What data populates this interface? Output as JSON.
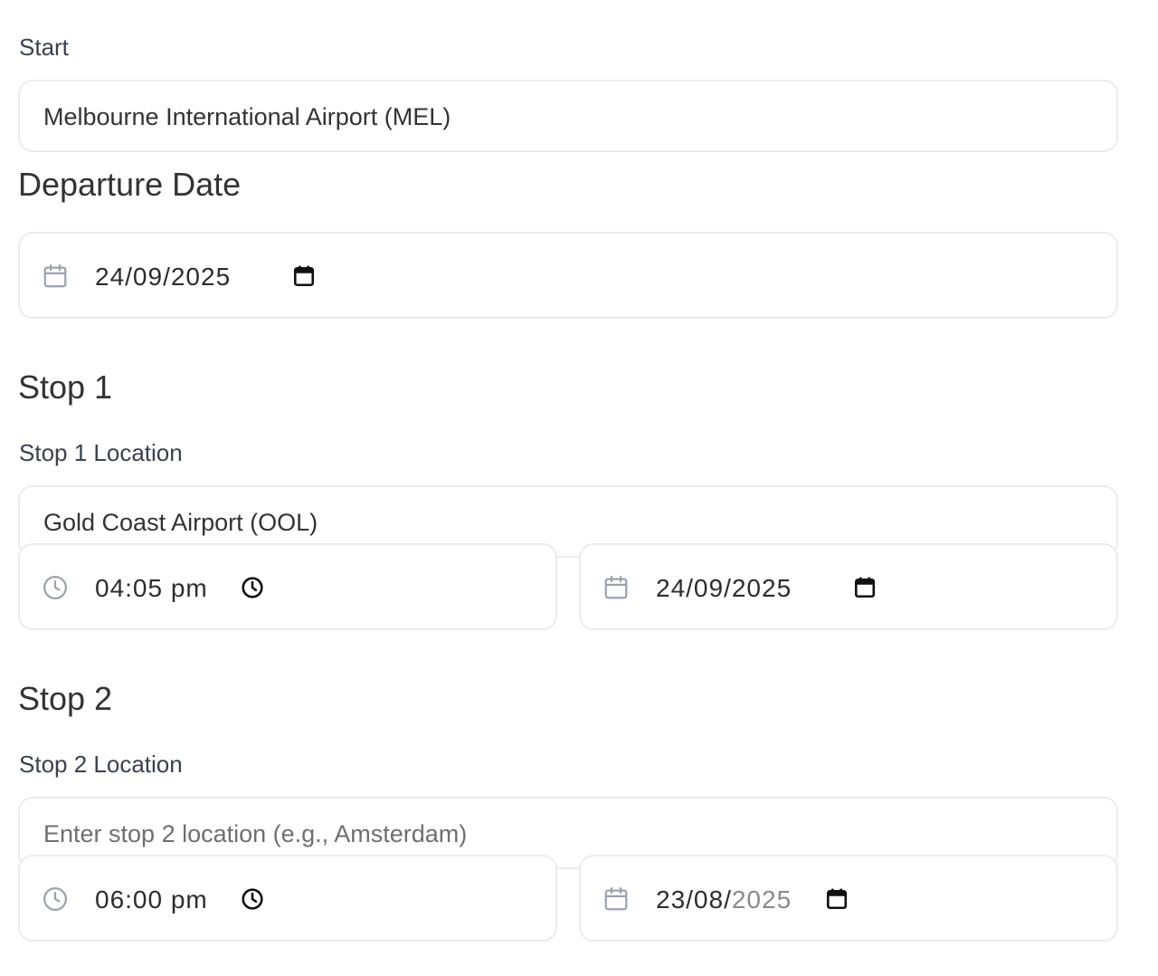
{
  "start": {
    "label": "Start",
    "value": "Melbourne International Airport (MEL)"
  },
  "departure": {
    "heading": "Departure Date",
    "date": "24/09/2025"
  },
  "stops": [
    {
      "heading": "Stop 1",
      "location_label": "Stop 1 Location",
      "location_value": "Gold Coast Airport (OOL)",
      "location_placeholder": "",
      "time": "04:05 pm",
      "date": "24/09/2025",
      "date_day_month": "",
      "date_year": ""
    },
    {
      "heading": "Stop 2",
      "location_label": "Stop 2 Location",
      "location_value": "",
      "location_placeholder": "Enter stop 2 location (e.g., Amsterdam)",
      "time": "06:00 pm",
      "date": "",
      "date_day_month": "23/08/",
      "date_year": "2025"
    }
  ],
  "icons": {
    "leading_calendar": "calendar-icon",
    "leading_clock": "clock-icon",
    "picker_calendar": "calendar-picker-icon",
    "picker_clock": "clock-picker-icon"
  },
  "colors": {
    "border": "#ececec",
    "text": "#333333",
    "label": "#374151",
    "icon_gray": "#9ca3af",
    "placeholder": "#6f6f6f"
  }
}
